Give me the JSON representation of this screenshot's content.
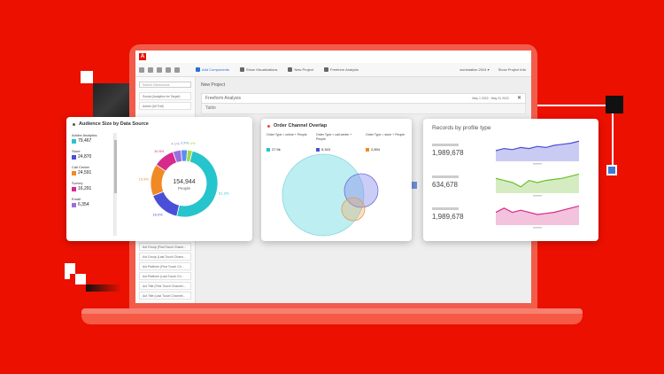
{
  "app": {
    "logo_letter": "A",
    "toolbar": {
      "items": [
        "Add Components",
        "Show Visualizations",
        "New Project",
        "Freeform Analysis"
      ],
      "right": [
        "workstation 2024 ▾",
        "Show Project Info"
      ]
    },
    "sidebar": {
      "search_placeholder": "Search Dimensions",
      "items_top": [
        "Social (Analytics for Target)",
        "Active (All Traf)"
      ],
      "items_bottom": [
        "Act Group (First Touch Chann...",
        "Act Group (Last Touch Chann...",
        "Act Platform (First Touch Ch...",
        "Act Platform (Last Touch Ch...",
        "Act Title (First Touch Channel...",
        "Act Title (Last Touch Channel..."
      ]
    },
    "main": {
      "project_title": "New Project",
      "panel_title": "Freeform Analysis",
      "date_range": "May 1 2022 - May 31 2022",
      "table_label": "Table"
    }
  },
  "audience_card": {
    "title": "Audience Size by Data Source",
    "entries": [
      {
        "name": "Adobe Analytics",
        "value": "79,467",
        "color": "#26c4cc"
      },
      {
        "name": "Store",
        "value": "24,870",
        "color": "#4a4fd8"
      },
      {
        "name": "Call Center",
        "value": "24,591",
        "color": "#f08a24"
      },
      {
        "name": "Survey",
        "value": "16,291",
        "color": "#d8298c"
      },
      {
        "name": "Email",
        "value": "6,354",
        "color": "#9c6ee0"
      }
    ],
    "center_value": "154,944",
    "center_label": "People",
    "slice_labels": [
      "51.3%",
      "16.0%",
      "15.9%",
      "10.5%",
      "4.1%",
      "3.3%",
      "2.4%"
    ]
  },
  "overlay_card": {
    "title": "Order Channel Overlap",
    "legend": [
      {
        "name": "Order Type = online + People",
        "value": "27.9k",
        "color": "#26c4cc"
      },
      {
        "name": "Order Type = call center + People",
        "value": "5,343",
        "color": "#4a4fd8"
      },
      {
        "name": "Order Type = store + People",
        "value": "2,894",
        "color": "#f08a24"
      }
    ]
  },
  "records_card": {
    "title": "Records by profile type",
    "rows": [
      {
        "value": "1,989,678",
        "color": "#4a4fd8",
        "fill": "#c9cbf3"
      },
      {
        "value": "634,678",
        "color": "#6abf2a",
        "fill": "#d5ecc2"
      },
      {
        "value": "1,989,678",
        "color": "#d8298c",
        "fill": "#f3c2dd"
      }
    ]
  },
  "chart_data": [
    {
      "type": "pie",
      "title": "Audience Size by Data Source",
      "categories": [
        "Adobe Analytics",
        "Store",
        "Call Center",
        "Survey",
        "Email"
      ],
      "values": [
        79467,
        24870,
        24591,
        16291,
        6354
      ]
    },
    {
      "type": "line",
      "title": "Records by profile type",
      "series": [
        {
          "values": [
            5,
            6,
            5.5,
            6.5,
            6,
            7,
            6.5,
            7.5,
            8,
            8.5,
            9.5
          ]
        },
        {
          "values": [
            7,
            6,
            5,
            3,
            6,
            5,
            6,
            6.5,
            7,
            8,
            9
          ]
        },
        {
          "values": [
            6,
            8,
            6,
            7,
            6,
            5,
            5.5,
            6,
            7,
            8,
            9
          ]
        }
      ]
    }
  ]
}
